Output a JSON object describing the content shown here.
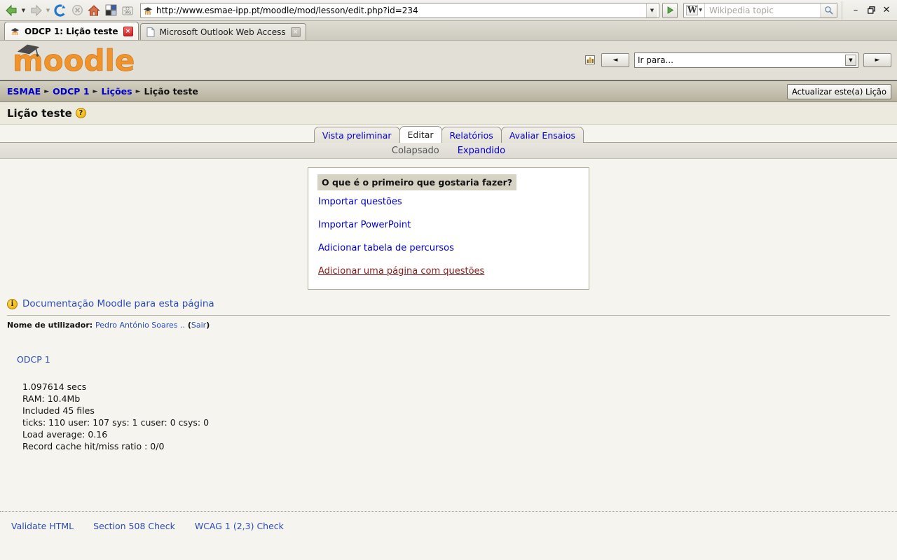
{
  "browser": {
    "url": "http://www.esmae-ipp.pt/moodle/mod/lesson/edit.php?id=234",
    "nav_icons": [
      "back-arrow-icon",
      "forward-arrow-icon",
      "reload-icon",
      "stop-icon",
      "home-icon",
      "grid-icon",
      "tag-icon"
    ],
    "go_button": "go-icon",
    "search": {
      "engine": "W",
      "placeholder": "Wikipedia topic",
      "value": "",
      "button": "search-icon"
    },
    "window_controls": {
      "minimize": "–",
      "maximize": "❐",
      "close": "✕"
    },
    "tabs": [
      {
        "title": "ODCP 1: Lição teste",
        "active": true,
        "favicon": "moodle-favicon",
        "close": "×"
      },
      {
        "title": "Microsoft Outlook Web Access",
        "active": false,
        "favicon": "page-icon",
        "close": "×"
      }
    ]
  },
  "site": {
    "logo_text": "moodle",
    "jump_menu": {
      "selected": "Ir para...",
      "prev_label": "◄",
      "next_label": "►"
    },
    "stats_icon": "bar-chart-icon"
  },
  "breadcrumb": {
    "items": [
      {
        "label": "ESMAE",
        "link": true
      },
      {
        "label": "ODCP 1",
        "link": true
      },
      {
        "label": "Lições",
        "link": true
      },
      {
        "label": "Lição teste",
        "link": false
      }
    ],
    "separator": "►",
    "update_button": "Actualizar este(a) Lição"
  },
  "page": {
    "title": "Lição teste",
    "help_icon_label": "?"
  },
  "tabs": {
    "items": [
      {
        "label": "Vista preliminar",
        "active": false
      },
      {
        "label": "Editar",
        "active": true
      },
      {
        "label": "Relatórios",
        "active": false
      },
      {
        "label": "Avaliar Ensaios",
        "active": false
      }
    ],
    "subtabs": [
      {
        "label": "Colapsado",
        "current": true
      },
      {
        "label": "Expandido",
        "current": false
      }
    ]
  },
  "lesson_box": {
    "heading": "O que é o primeiro que gostaria fazer?",
    "options": [
      {
        "label": "Importar questões",
        "visited": false
      },
      {
        "label": "Importar PowerPoint",
        "visited": false
      },
      {
        "label": "Adicionar tabela de percursos",
        "visited": false
      },
      {
        "label": "Adicionar uma página com questões",
        "visited": true
      }
    ]
  },
  "footer": {
    "docs_link": "Documentação Moodle para esta página",
    "docs_icon_label": "i",
    "username_label": "Nome de utilizador:",
    "username": "Pedro António Soares ..",
    "logout_open": "(",
    "logout": "Sair",
    "logout_close": ")",
    "course_link": "ODCP 1",
    "performance": [
      "1.097614 secs",
      "RAM: 10.4Mb",
      "Included 45 files",
      "ticks: 110 user: 107 sys: 1 cuser: 0 csys: 0",
      "Load average: 0.16",
      "Record cache hit/miss ratio : 0/0"
    ],
    "validation_links": [
      "Validate HTML",
      "Section 508 Check",
      "WCAG 1 (2,3) Check"
    ]
  },
  "colors": {
    "link": "#0000cc",
    "visited_link": "#8b1a1a",
    "logo_orange": "#f0932b",
    "header_bg": "#e2dfd6",
    "breadcrumb_bg": "#c5c0ae",
    "page_bg": "#f5f4ef"
  }
}
